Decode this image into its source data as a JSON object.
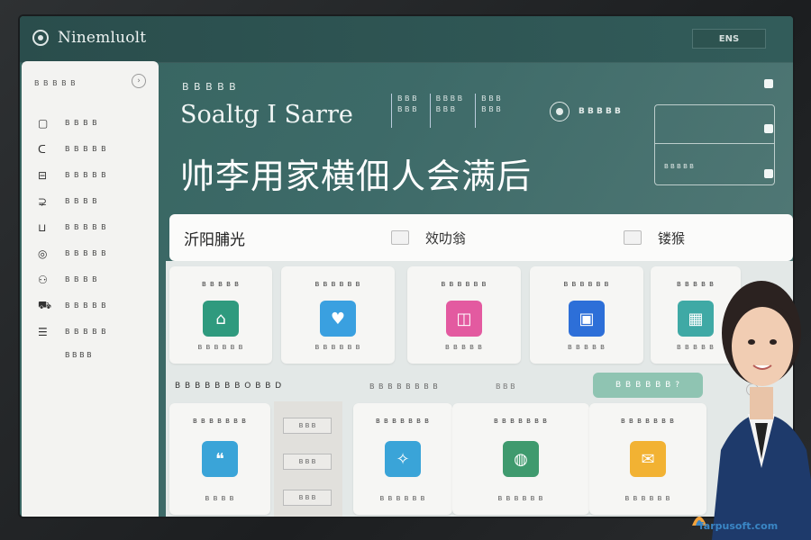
{
  "app": {
    "name": "Ninemluolt",
    "top_button": "ENS"
  },
  "sidebar": {
    "header": "B B B B B",
    "toggle_icon": "chevron-circle-icon",
    "items": [
      {
        "icon": "box-icon",
        "label": "B B B B"
      },
      {
        "icon": "c-icon",
        "label": "B B B B B"
      },
      {
        "icon": "monitor-icon",
        "label": "B B B B B"
      },
      {
        "icon": "chat-icon",
        "label": "B B B B"
      },
      {
        "icon": "chart-icon",
        "label": "B B B B B"
      },
      {
        "icon": "globe-icon",
        "label": "B B B B B"
      },
      {
        "icon": "people-icon",
        "label": "B B B B"
      },
      {
        "icon": "car-icon",
        "label": "B B B B B"
      },
      {
        "icon": "list-icon",
        "label": "B B B B B"
      }
    ],
    "extra_label": "B B B B"
  },
  "hero": {
    "eyebrow": "B B B B B",
    "subtitle": "Soaltg I Sarre",
    "title": "帅李用家横佃人会满后",
    "stats": [
      "B B B\nB B B",
      "B B B B\nB B B",
      "B B B\nB B B"
    ],
    "toggle_label": "B B B B B",
    "panel_label": "B B B B B"
  },
  "filter": {
    "title": "沂阳脯光",
    "middle": "效叻翁",
    "right": "镂猴"
  },
  "cards_top": [
    {
      "title": "B B B B B",
      "footer": "B B B B B B",
      "icon": "home-icon",
      "color": "#2f9a7e"
    },
    {
      "title": "B B B B B B",
      "footer": "B B B B B B",
      "icon": "heart-image-icon",
      "color": "#3aa0e0"
    },
    {
      "title": "B B B B B B",
      "footer": "B B B B B",
      "icon": "bag-icon",
      "color": "#e35aa0"
    },
    {
      "title": "B B B B B B",
      "footer": "B B B B B",
      "icon": "photo-icon",
      "color": "#2d6fd8"
    },
    {
      "title": "B B B B B",
      "footer": "B B B B B",
      "icon": "grid-icon",
      "color": "#3fa9a5"
    }
  ],
  "row_mid": {
    "left": "B B B B B B B O B B D",
    "middle": "B B B B B B B B",
    "right": "B B B"
  },
  "cta_label": "B B B B B B ?",
  "cards_bottom": [
    {
      "title": "B B B B B B B",
      "footer": "B B B B",
      "icon": "speech-icon",
      "color": "#3aa4d8"
    },
    {
      "title": "B B B B B B B",
      "footer": "B B B B B B",
      "icon": "lamp-icon",
      "color": "#3aa4d8"
    },
    {
      "title": "B B B B B B B",
      "footer": "B B B B B B",
      "icon": "spiral-icon",
      "color": "#3f9a6e"
    },
    {
      "title": "B B B B B B B",
      "footer": "B B B B B B",
      "icon": "mail-icon",
      "color": "#f2b233"
    }
  ],
  "gap_block": {
    "buttons": [
      "B B B",
      "B B B",
      "B B B"
    ]
  },
  "watermark": "farpusoft.com",
  "colors": {
    "accent": "#3d6a68",
    "cta": "#8fc4b2",
    "sidebar_bg": "#f3f3f1"
  }
}
